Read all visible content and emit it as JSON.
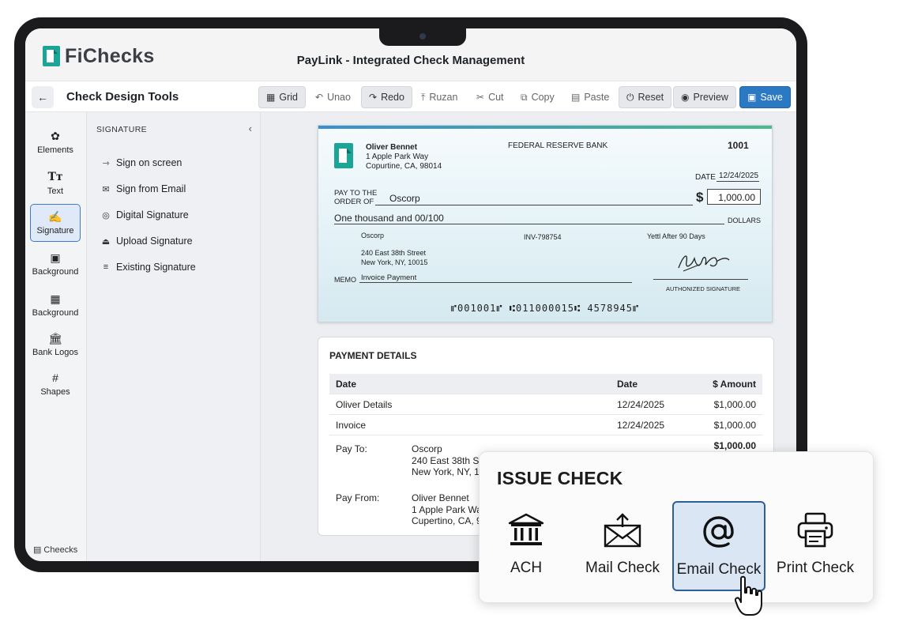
{
  "app": {
    "brand": "FiChecks",
    "brand_prefix": "F",
    "brand_suffix": "iChecks",
    "window_title": "PayLink - Integrated Check Management"
  },
  "toolbar": {
    "title": "Check Design Tools",
    "grid": "Grid",
    "undo": "Unao",
    "redo": "Redo",
    "ruzan": "Ruzan",
    "cut": "Cut",
    "copy": "Copy",
    "paste": "Paste",
    "reset": "Reset",
    "preview": "Preview",
    "save": "Save"
  },
  "rail": {
    "items": [
      {
        "label": "Elements",
        "icon": "elements-icon"
      },
      {
        "label": "Text",
        "icon": "text-icon"
      },
      {
        "label": "Signature",
        "icon": "signature-icon",
        "active": true
      },
      {
        "label": "Background",
        "icon": "image-icon"
      },
      {
        "label": "Background",
        "icon": "grid-icon"
      },
      {
        "label": "Bank Logos",
        "icon": "bank-icon"
      },
      {
        "label": "Shapes",
        "icon": "hash-icon"
      }
    ],
    "footer": "Cheecks"
  },
  "panel": {
    "title": "SIGNATURE",
    "items": [
      "Sign on screen",
      "Sign from Email",
      "Digital Signature",
      "Upload Signature",
      "Existing Signature"
    ]
  },
  "check": {
    "payer_name": "Oliver Bennet",
    "payer_addr1": "1 Apple Park Way",
    "payer_addr2": "Copurtine, CA, 98014",
    "bank": "FEDERAL RESERVE BANK",
    "number": "1001",
    "date_label": "DATE",
    "date": "12/24/2025",
    "pay_to_label_1": "PAY TO THE",
    "pay_to_label_2": "ORDER OF",
    "payee": "Oscorp",
    "currency": "$",
    "amount": "1,000.00",
    "amount_words": "One thousand and 00/100",
    "dollars": "DOLLARS",
    "payee_block_name": "Oscorp",
    "payee_addr1": "240 East 38th Street",
    "payee_addr2": "New York, NY, 10015",
    "invoice": "INV-798754",
    "terms": "Yettl After 90 Days",
    "memo_label": "MEMO",
    "memo": "Invoice Payment",
    "signature_label": "AUTHONIZED SIGNATURE",
    "micr": "⑈001001⑈ ⑆011000015⑆ 4578945⑈",
    "accent": "#3a8fd0"
  },
  "payment": {
    "title": "PAYMENT DETAILS",
    "columns": [
      "Date",
      "Date",
      "$ Amount"
    ],
    "rows": [
      [
        "Oliver Details",
        "12/24/2025",
        "$1,000.00"
      ],
      [
        "Invoice",
        "12/24/2025",
        "$1,000.00"
      ]
    ],
    "total": "$1,000.00",
    "pay_to_label": "Pay To:",
    "pay_to": [
      "Oscorp",
      "240 East 38th St",
      "New York, NY, 10"
    ],
    "pay_from_label": "Pay From:",
    "pay_from": [
      "Oliver Bennet",
      "1 Apple Park Wa",
      "Cupertino, CA, 9"
    ]
  },
  "issue": {
    "title": "ISSUE CHECK",
    "options": [
      {
        "label": "ACH",
        "icon": "bank-icon"
      },
      {
        "label": "Mail Check",
        "icon": "mail-icon"
      },
      {
        "label": "Email Check",
        "icon": "at-icon",
        "selected": true
      },
      {
        "label": "Print Check",
        "icon": "printer-icon"
      }
    ]
  },
  "colors": {
    "primary": "#2b79c2",
    "brand_teal": "#1aa597",
    "selected_border": "#2f5f97"
  }
}
